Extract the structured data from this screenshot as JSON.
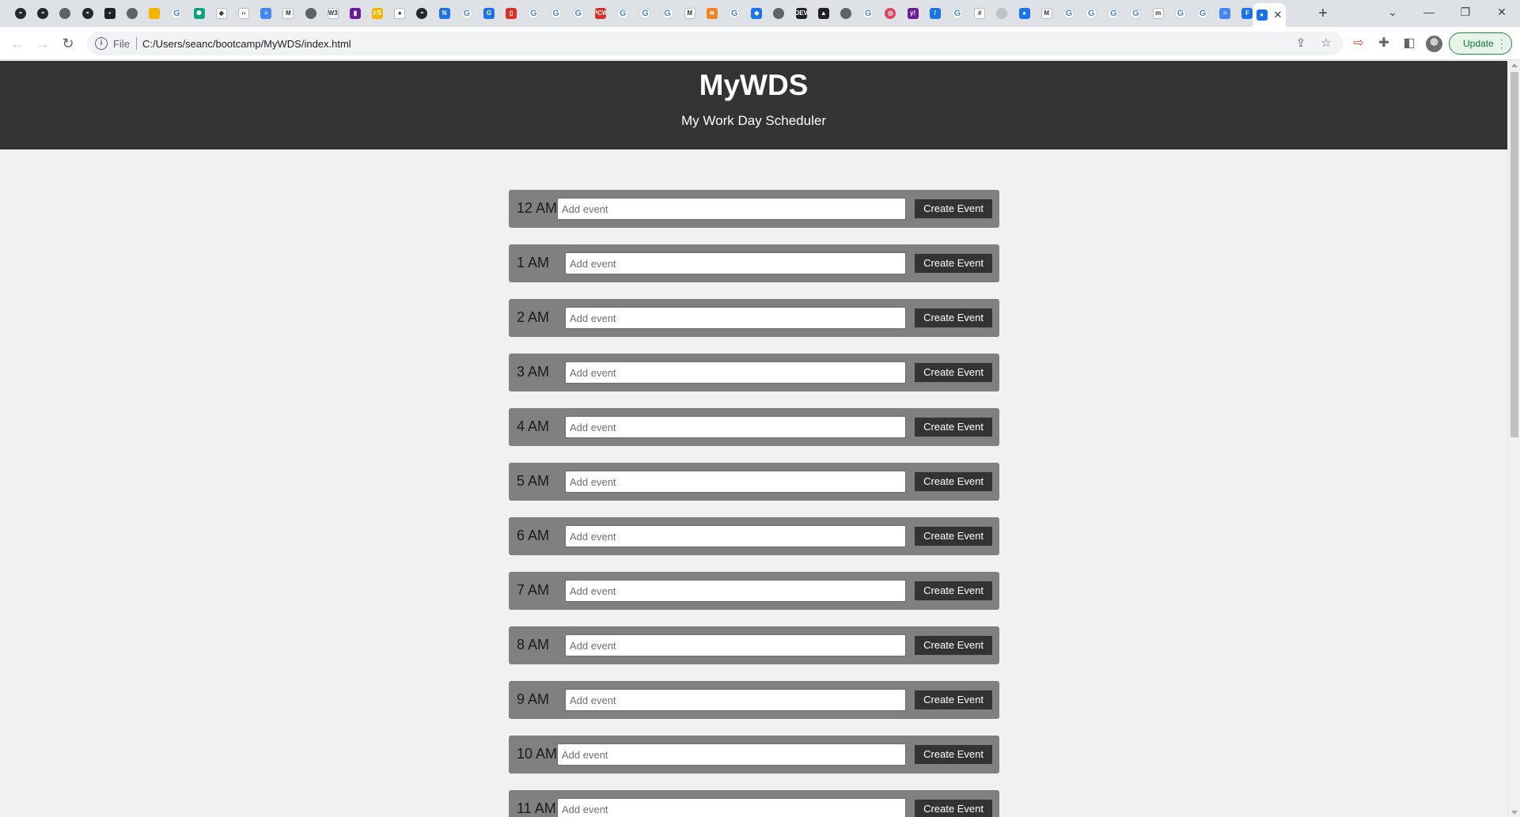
{
  "browser": {
    "url": "C:/Users/seanc/bootcamp/MyWDS/index.html",
    "scheme_label": "File",
    "update_label": "Update",
    "tab_favicons": [
      {
        "name": "github-icon",
        "cls": "gh",
        "glyph": "◓"
      },
      {
        "name": "github-icon",
        "cls": "gh",
        "glyph": "◓"
      },
      {
        "name": "globe-icon",
        "cls": "globe",
        "glyph": ""
      },
      {
        "name": "github-icon",
        "cls": "gh",
        "glyph": "◓"
      },
      {
        "name": "site-icon",
        "cls": "dk",
        "glyph": "▪"
      },
      {
        "name": "globe-icon",
        "cls": "globe",
        "glyph": ""
      },
      {
        "name": "slides-icon",
        "cls": "yel",
        "glyph": ""
      },
      {
        "name": "google-icon",
        "cls": "g",
        "glyph": "G"
      },
      {
        "name": "chatgpt-icon",
        "cls": "teal",
        "glyph": "✺"
      },
      {
        "name": "codepen-icon",
        "cls": "wht",
        "glyph": "◈"
      },
      {
        "name": "code-icon",
        "cls": "wht",
        "glyph": "‹›"
      },
      {
        "name": "docs-icon",
        "cls": "doc",
        "glyph": "≡"
      },
      {
        "name": "site-icon",
        "cls": "wht",
        "glyph": "M"
      },
      {
        "name": "globe-icon",
        "cls": "globe",
        "glyph": ""
      },
      {
        "name": "w3schools-icon",
        "cls": "wht",
        "glyph": "W3"
      },
      {
        "name": "site-icon",
        "cls": "pur",
        "glyph": "▮"
      },
      {
        "name": "site-icon",
        "cls": "yel",
        "glyph": "FS"
      },
      {
        "name": "apple-icon",
        "cls": "wht",
        "glyph": "●"
      },
      {
        "name": "github-icon",
        "cls": "gh",
        "glyph": "◓"
      },
      {
        "name": "site-icon",
        "cls": "blu",
        "glyph": "N"
      },
      {
        "name": "google-icon",
        "cls": "g",
        "glyph": "G"
      },
      {
        "name": "site-icon",
        "cls": "blu",
        "glyph": "G"
      },
      {
        "name": "site-icon",
        "cls": "red",
        "glyph": "▯"
      },
      {
        "name": "google-icon",
        "cls": "g",
        "glyph": "G"
      },
      {
        "name": "google-icon",
        "cls": "g",
        "glyph": "G"
      },
      {
        "name": "google-icon",
        "cls": "g",
        "glyph": "G"
      },
      {
        "name": "site-icon",
        "cls": "red",
        "glyph": "PCW"
      },
      {
        "name": "google-icon",
        "cls": "g",
        "glyph": "G"
      },
      {
        "name": "google-icon",
        "cls": "g",
        "glyph": "G"
      },
      {
        "name": "google-icon",
        "cls": "g",
        "glyph": "G"
      },
      {
        "name": "site-icon",
        "cls": "wht",
        "glyph": "M"
      },
      {
        "name": "stackoverflow-icon",
        "cls": "org",
        "glyph": "≋"
      },
      {
        "name": "google-icon",
        "cls": "g",
        "glyph": "G"
      },
      {
        "name": "site-icon",
        "cls": "blu",
        "glyph": "◆"
      },
      {
        "name": "globe-icon",
        "cls": "globe",
        "glyph": ""
      },
      {
        "name": "dev-icon",
        "cls": "dk",
        "glyph": "DEV"
      },
      {
        "name": "site-icon",
        "cls": "dk",
        "glyph": "▲"
      },
      {
        "name": "globe-icon",
        "cls": "globe",
        "glyph": ""
      },
      {
        "name": "google-icon",
        "cls": "g",
        "glyph": "G"
      },
      {
        "name": "site-icon",
        "cls": "pink",
        "glyph": "◎"
      },
      {
        "name": "yahoo-icon",
        "cls": "pur",
        "glyph": "y!"
      },
      {
        "name": "site-icon",
        "cls": "blu",
        "glyph": "/"
      },
      {
        "name": "google-icon",
        "cls": "g",
        "glyph": "G"
      },
      {
        "name": "slack-icon",
        "cls": "wht",
        "glyph": "#"
      },
      {
        "name": "site-icon",
        "cls": "gry",
        "glyph": ""
      },
      {
        "name": "site-icon",
        "cls": "blu",
        "glyph": "●"
      },
      {
        "name": "gmail-icon",
        "cls": "wht",
        "glyph": "M"
      },
      {
        "name": "google-icon",
        "cls": "g",
        "glyph": "G"
      },
      {
        "name": "google-icon",
        "cls": "g",
        "glyph": "G"
      },
      {
        "name": "google-icon",
        "cls": "g",
        "glyph": "G"
      },
      {
        "name": "google-icon",
        "cls": "g",
        "glyph": "G"
      },
      {
        "name": "site-icon",
        "cls": "wht",
        "glyph": "m"
      },
      {
        "name": "google-icon",
        "cls": "g",
        "glyph": "G"
      },
      {
        "name": "google-icon",
        "cls": "g",
        "glyph": "G"
      },
      {
        "name": "docs-icon",
        "cls": "doc",
        "glyph": "≡"
      },
      {
        "name": "site-icon",
        "cls": "blu",
        "glyph": "F"
      }
    ],
    "active_tab_icon": {
      "name": "site-icon",
      "cls": "blu",
      "glyph": "●"
    }
  },
  "header": {
    "title": "MyWDS",
    "subtitle": "My Work Day Scheduler"
  },
  "schedule": {
    "input_placeholder": "Add event",
    "button_label": "Create Event",
    "hours": [
      "12 AM",
      "1 AM",
      "2 AM",
      "3 AM",
      "4 AM",
      "5 AM",
      "6 AM",
      "7 AM",
      "8 AM",
      "9 AM",
      "10 AM",
      "11 AM"
    ]
  },
  "colors": {
    "header_bg": "#333333",
    "row_bg": "#808080",
    "button_bg": "#333333",
    "page_bg": "#f1f1f1"
  }
}
